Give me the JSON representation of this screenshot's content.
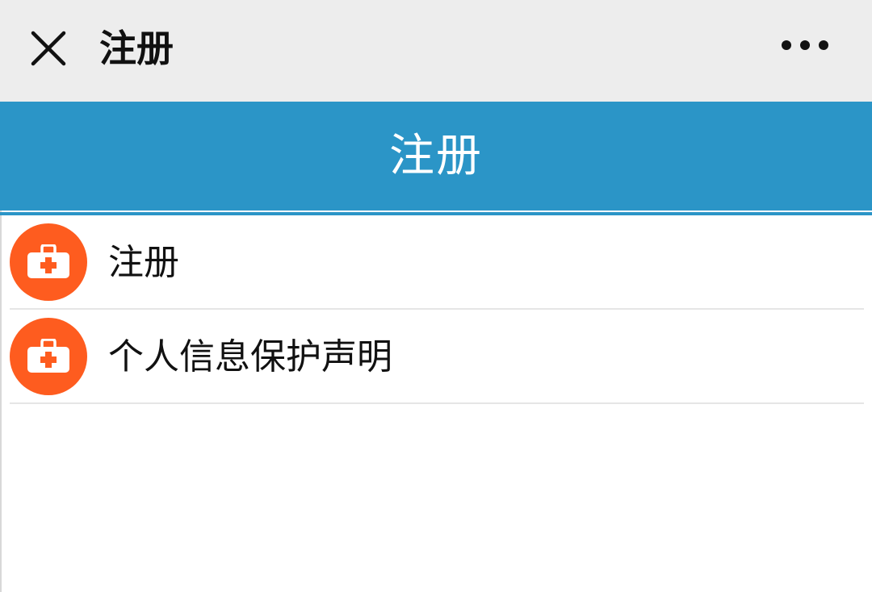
{
  "nav": {
    "title": "注册",
    "close_icon": "close-icon",
    "more_icon": "more-icon"
  },
  "banner": {
    "title": "注册"
  },
  "list": {
    "items": [
      {
        "label": "注册",
        "icon": "medical-kit-icon"
      },
      {
        "label": "个人信息保护声明",
        "icon": "medical-kit-icon"
      }
    ]
  },
  "colors": {
    "nav_bg": "#ededed",
    "banner_bg": "#2b95c7",
    "icon_bg": "#fe5c1f"
  }
}
